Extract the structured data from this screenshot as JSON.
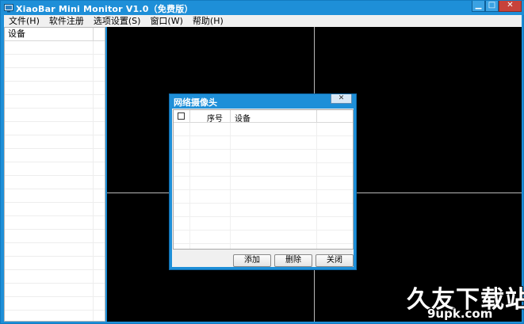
{
  "window": {
    "title": "XiaoBar Mini Monitor V1.0（免费版）",
    "min_glyph": "▁",
    "max_glyph": "□",
    "close_glyph": "✕"
  },
  "menu": {
    "items": [
      "文件(H)",
      "软件注册",
      "选项设置(S)",
      "窗口(W)",
      "帮助(H)"
    ]
  },
  "sidebar": {
    "header": "设备"
  },
  "dialog": {
    "title": "网络摄像头",
    "close_glyph": "✕",
    "columns": {
      "index": "序号",
      "device": "设备"
    },
    "buttons": {
      "add": "添加",
      "delete": "删除",
      "close": "关闭"
    }
  },
  "watermark": {
    "main": "久友下载站",
    "sub": "9upk.com"
  },
  "colors": {
    "frame": "#1e8fd8",
    "monitor_bg": "#000000",
    "grid_line": "#b8b8b8"
  }
}
